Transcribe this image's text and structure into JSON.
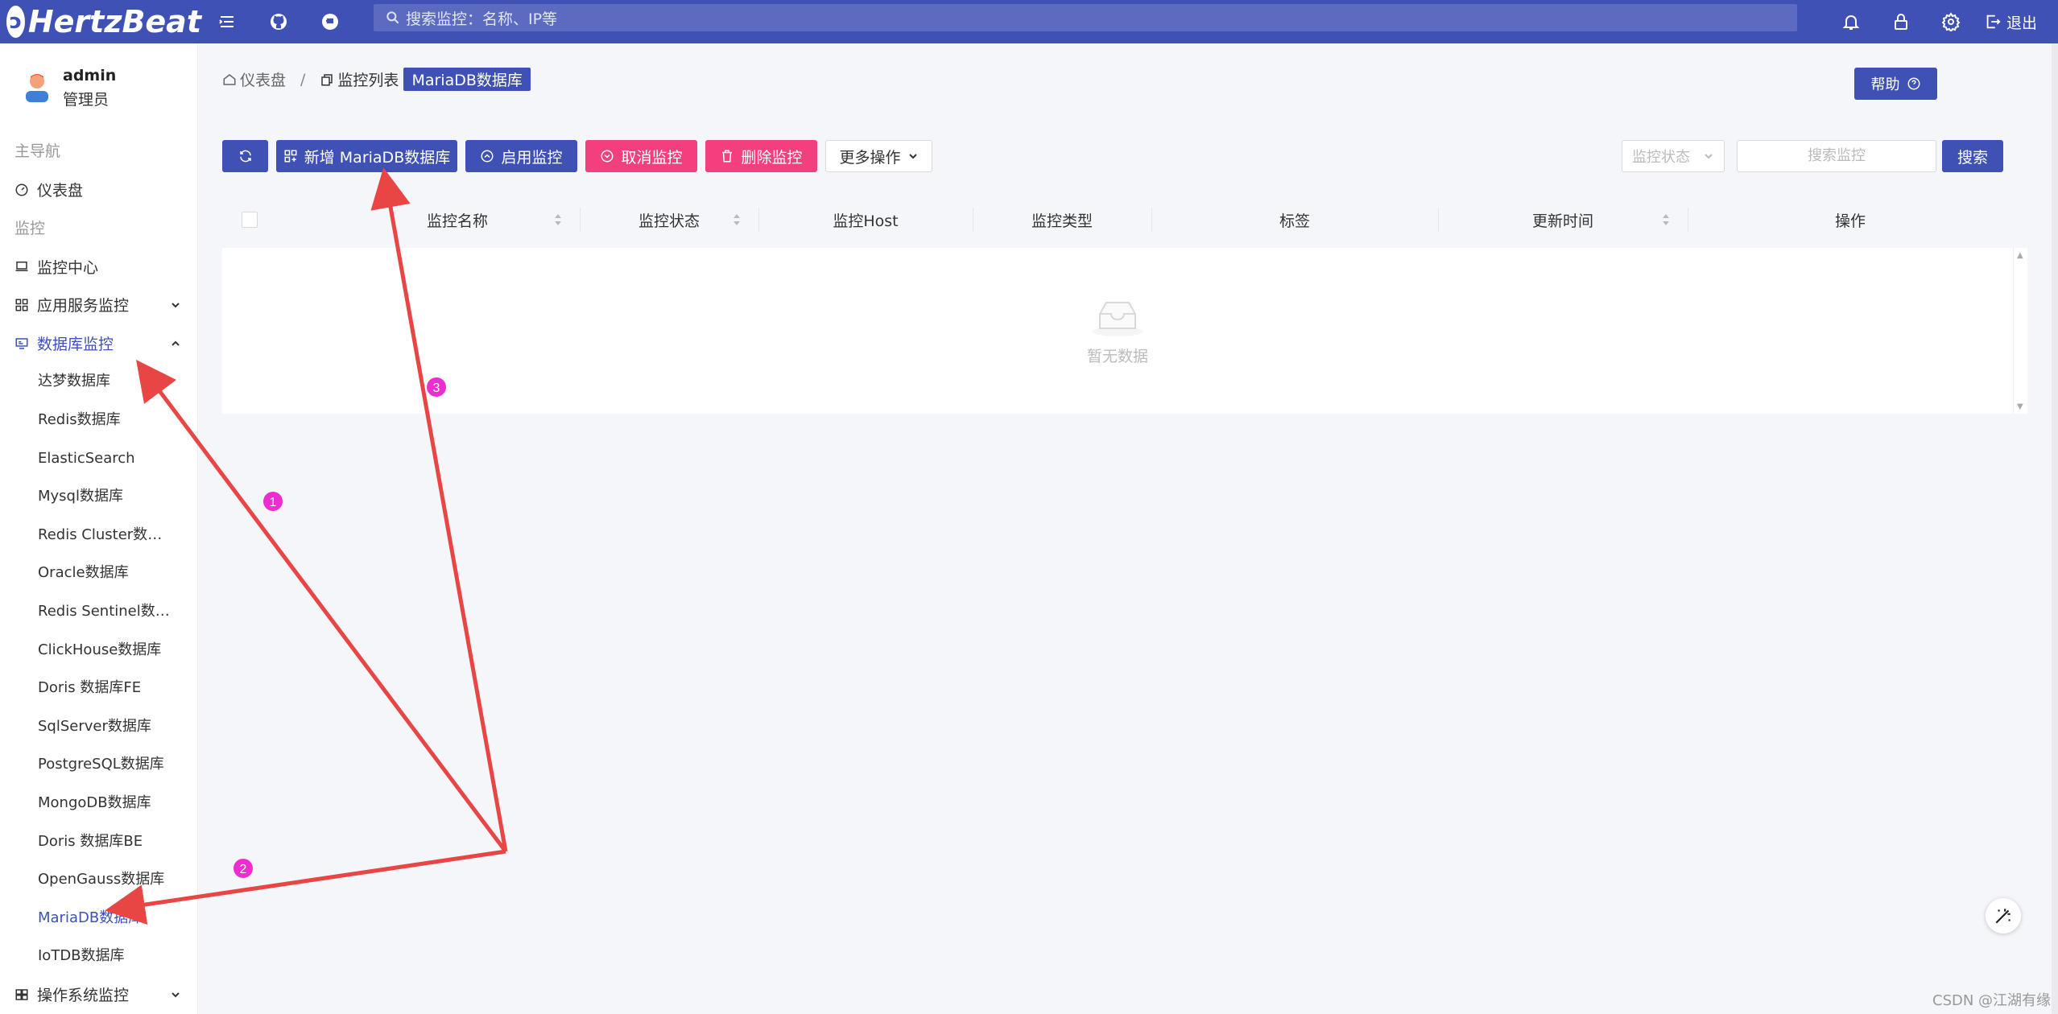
{
  "header": {
    "logo_text": "HertzBeat",
    "search_placeholder": "搜索监控：名称、IP等",
    "logout_label": "退出"
  },
  "user": {
    "name": "admin",
    "role": "管理员"
  },
  "sidebar": {
    "group_main": "主导航",
    "dashboard": "仪表盘",
    "group_monitor": "监控",
    "monitor_center": "监控中心",
    "app_service": "应用服务监控",
    "database_monitor": "数据库监控",
    "db_items": [
      "达梦数据库",
      "Redis数据库",
      "ElasticSearch",
      "Mysql数据库",
      "Redis Cluster数据库",
      "Oracle数据库",
      "Redis Sentinel数据库",
      "ClickHouse数据库",
      "Doris 数据库FE",
      "SqlServer数据库",
      "PostgreSQL数据库",
      "MongoDB数据库",
      "Doris 数据库BE",
      "OpenGauss数据库",
      "MariaDB数据库",
      "IoTDB数据库"
    ],
    "db_items_truncated": {
      "6": "Redis Sentinel数据..."
    },
    "os_monitor": "操作系统监控",
    "selected_item": "MariaDB数据库"
  },
  "breadcrumb": {
    "home": "仪表盘",
    "list": "监控列表",
    "current": "MariaDB数据库"
  },
  "help_label": "帮助",
  "toolbar": {
    "add": "新增 MariaDB数据库",
    "enable": "启用监控",
    "cancel": "取消监控",
    "delete": "删除监控",
    "more": "更多操作"
  },
  "filter": {
    "status_placeholder": "监控状态",
    "search_placeholder": "搜索监控",
    "search_button": "搜索"
  },
  "table": {
    "columns": [
      "监控名称",
      "监控状态",
      "监控Host",
      "监控类型",
      "标签",
      "更新时间",
      "操作"
    ],
    "empty_text": "暂无数据"
  },
  "annotations": {
    "markers": [
      "1",
      "2",
      "3"
    ],
    "arrow_color": "#e84545",
    "marker_color": "#ee2dd0"
  },
  "watermark": "CSDN @江湖有缘",
  "colors": {
    "primary": "#3f51b5",
    "danger": "#f43f7f"
  }
}
